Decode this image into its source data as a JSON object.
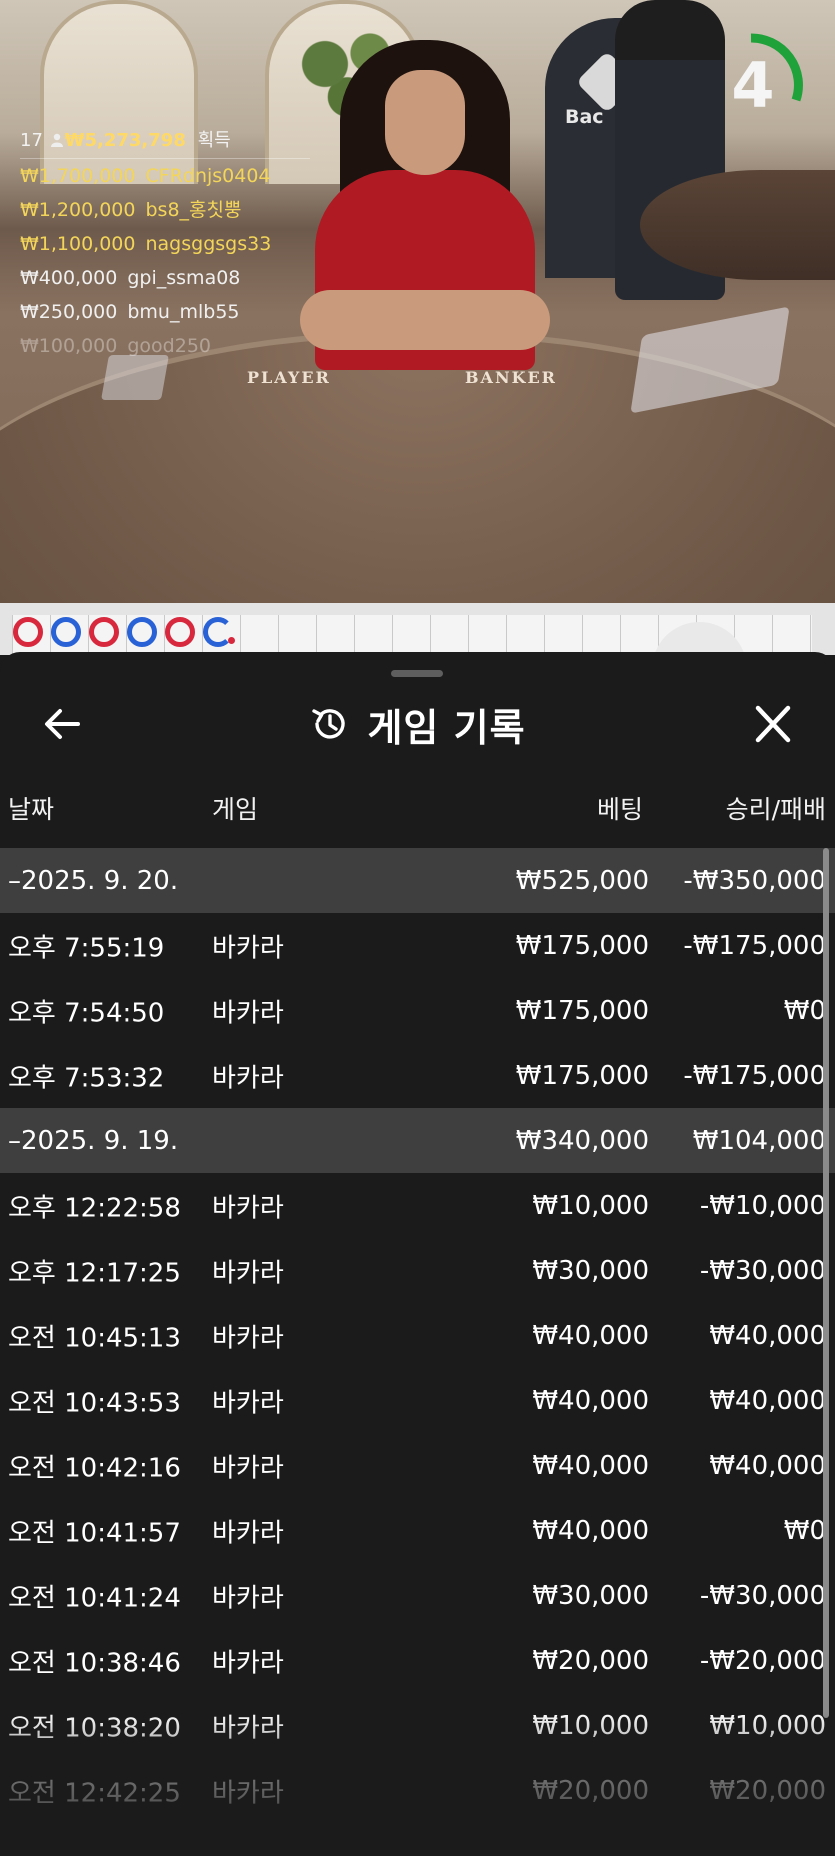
{
  "video": {
    "table_player": "PLAYER",
    "table_banker": "BANKER",
    "brand": "Bac",
    "countdown": "4",
    "countdown_color": "#1fa23a"
  },
  "winners": {
    "count": "17",
    "total": "₩5,273,798",
    "suffix": "획득",
    "list": [
      {
        "amount": "₩1,700,000",
        "name": "CFRdnjs0404"
      },
      {
        "amount": "₩1,200,000",
        "name": "bs8_홍칫뿡"
      },
      {
        "amount": "₩1,100,000",
        "name": "nagsggsgs33"
      },
      {
        "amount": "₩400,000",
        "name": "gpi_ssma08"
      },
      {
        "amount": "₩250,000",
        "name": "bmu_mlb55"
      },
      {
        "amount": "₩100,000",
        "name": "good250"
      }
    ]
  },
  "road": {
    "beads": [
      "red",
      "blue",
      "red",
      "blue",
      "red",
      "blue"
    ]
  },
  "history": {
    "title": "게임 기록",
    "icons": {
      "back": "back-arrow-icon",
      "history": "history-icon",
      "close": "close-icon"
    },
    "columns": {
      "date": "날짜",
      "game": "게임",
      "bet": "베팅",
      "result": "승리/패배"
    },
    "days": [
      {
        "date": "–2025. 9. 20.",
        "bet": "₩525,000",
        "result": "-₩350,000",
        "rows": [
          {
            "time": "오후 7:55:19",
            "game": "바카라",
            "bet": "₩175,000",
            "result": "-₩175,000"
          },
          {
            "time": "오후 7:54:50",
            "game": "바카라",
            "bet": "₩175,000",
            "result": "₩0"
          },
          {
            "time": "오후 7:53:32",
            "game": "바카라",
            "bet": "₩175,000",
            "result": "-₩175,000"
          }
        ]
      },
      {
        "date": "–2025. 9. 19.",
        "bet": "₩340,000",
        "result": "₩104,000",
        "rows": [
          {
            "time": "오후 12:22:58",
            "game": "바카라",
            "bet": "₩10,000",
            "result": "-₩10,000"
          },
          {
            "time": "오후 12:17:25",
            "game": "바카라",
            "bet": "₩30,000",
            "result": "-₩30,000"
          },
          {
            "time": "오전 10:45:13",
            "game": "바카라",
            "bet": "₩40,000",
            "result": "₩40,000"
          },
          {
            "time": "오전 10:43:53",
            "game": "바카라",
            "bet": "₩40,000",
            "result": "₩40,000"
          },
          {
            "time": "오전 10:42:16",
            "game": "바카라",
            "bet": "₩40,000",
            "result": "₩40,000"
          },
          {
            "time": "오전 10:41:57",
            "game": "바카라",
            "bet": "₩40,000",
            "result": "₩0"
          },
          {
            "time": "오전 10:41:24",
            "game": "바카라",
            "bet": "₩30,000",
            "result": "-₩30,000"
          },
          {
            "time": "오전 10:38:46",
            "game": "바카라",
            "bet": "₩20,000",
            "result": "-₩20,000"
          },
          {
            "time": "오전 10:38:20",
            "game": "바카라",
            "bet": "₩10,000",
            "result": "₩10,000"
          },
          {
            "time": "오전 12:42:25",
            "game": "바카라",
            "bet": "₩20,000",
            "result": "₩20,000"
          }
        ]
      }
    ]
  }
}
